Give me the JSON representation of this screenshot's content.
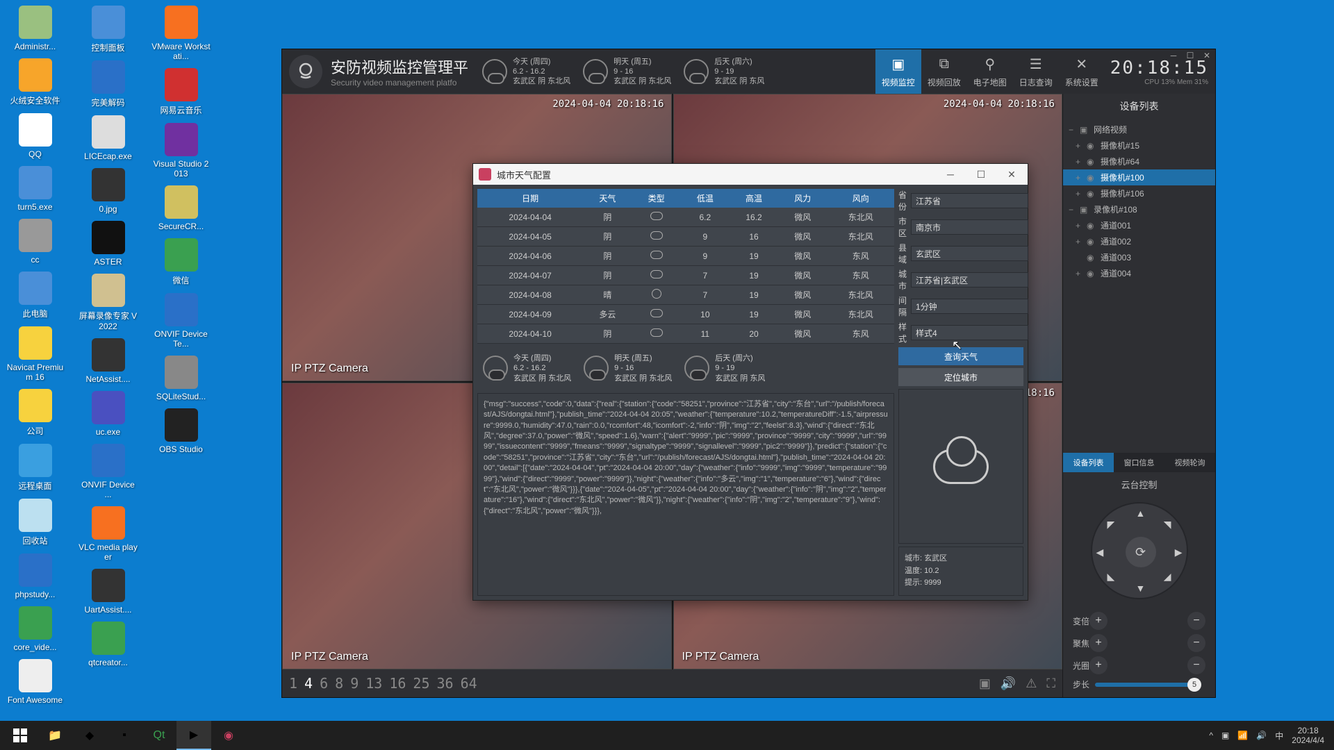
{
  "desktop_icons": [
    {
      "label": "Administr...",
      "bg": "#9ac080"
    },
    {
      "label": "火绒安全软件",
      "bg": "#f7a52a"
    },
    {
      "label": "QQ",
      "bg": "#fff"
    },
    {
      "label": "turn5.exe",
      "bg": "#4a8fd8"
    },
    {
      "label": "cc",
      "bg": "#999"
    },
    {
      "label": "此电脑",
      "bg": "#4a8fd8"
    },
    {
      "label": "Navicat Premium 16",
      "bg": "#f7d23e"
    },
    {
      "label": "公司",
      "bg": "#f7d23e"
    },
    {
      "label": "远程桌面",
      "bg": "#3a9fe0"
    },
    {
      "label": "回收站",
      "bg": "#bce0f0"
    },
    {
      "label": "phpstudy...",
      "bg": "#2a70c8"
    },
    {
      "label": "core_vide...",
      "bg": "#3aa050"
    },
    {
      "label": "Font Awesome",
      "bg": "#eee"
    },
    {
      "label": "控制面板",
      "bg": "#4a8fd8"
    },
    {
      "label": "完美解码",
      "bg": "#2a70c8"
    },
    {
      "label": "LICEcap.exe",
      "bg": "#ddd"
    },
    {
      "label": "0.jpg",
      "bg": "#333"
    },
    {
      "label": "ASTER",
      "bg": "#111"
    },
    {
      "label": "屏幕录像专家 V2022",
      "bg": "#d0c090"
    },
    {
      "label": "NetAssist....",
      "bg": "#333"
    },
    {
      "label": "uc.exe",
      "bg": "#4a50c0"
    },
    {
      "label": "ONVIF Device ...",
      "bg": "#2a70c8"
    },
    {
      "label": "VLC media player",
      "bg": "#f77020"
    },
    {
      "label": "UartAssist....",
      "bg": "#333"
    },
    {
      "label": "qtcreator...",
      "bg": "#3aa050"
    },
    {
      "label": "VMware Workstati...",
      "bg": "#f77020"
    },
    {
      "label": "网易云音乐",
      "bg": "#d03030"
    },
    {
      "label": "Visual Studio 2013",
      "bg": "#7030a0"
    },
    {
      "label": "SecureCR...",
      "bg": "#d0c060"
    },
    {
      "label": "微信",
      "bg": "#3aa050"
    },
    {
      "label": "ONVIF Device Te...",
      "bg": "#2a70c8"
    },
    {
      "label": "SQLiteStud...",
      "bg": "#888"
    },
    {
      "label": "OBS Studio",
      "bg": "#222"
    }
  ],
  "app": {
    "title_cn": "安防视频监控管理平",
    "title_en": "Security video management platfo",
    "clock": "20:18:15",
    "cpu": "CPU 13%  Mem 31%",
    "nav": [
      {
        "label": "视频监控",
        "active": true
      },
      {
        "label": "视频回放"
      },
      {
        "label": "电子地图"
      },
      {
        "label": "日志查询"
      },
      {
        "label": "系统设置"
      }
    ],
    "weather_strip": [
      {
        "day": "今天 (周四)",
        "temp": "6.2 - 16.2",
        "loc": "玄武区  阴 东北风"
      },
      {
        "day": "明天 (周五)",
        "temp": "9 - 16",
        "loc": "玄武区  阴 东北风"
      },
      {
        "day": "后天 (周六)",
        "temp": "9 - 19",
        "loc": "玄武区  阴 东风"
      }
    ],
    "video_ts": "2024-04-04 20:18:16",
    "video_label": "IP PTZ Camera",
    "layout_nums": [
      "1",
      "4",
      "6",
      "8",
      "9",
      "13",
      "16",
      "25",
      "36",
      "64"
    ],
    "active_layout": "4",
    "side": {
      "title": "设备列表",
      "tree": [
        {
          "lvl": 0,
          "label": "网络视频",
          "t": "−",
          "i": "▣"
        },
        {
          "lvl": 1,
          "label": "摄像机#15",
          "t": "+",
          "i": "◉"
        },
        {
          "lvl": 1,
          "label": "摄像机#64",
          "t": "+",
          "i": "◉"
        },
        {
          "lvl": 1,
          "label": "摄像机#100",
          "t": "+",
          "i": "◉",
          "sel": true
        },
        {
          "lvl": 1,
          "label": "摄像机#106",
          "t": "+",
          "i": "◉"
        },
        {
          "lvl": 0,
          "label": "录像机#108",
          "t": "−",
          "i": "▣"
        },
        {
          "lvl": 1,
          "label": "通道001",
          "t": "+",
          "i": "◉"
        },
        {
          "lvl": 1,
          "label": "通道002",
          "t": "+",
          "i": "◉"
        },
        {
          "lvl": 1,
          "label": "通道003",
          "t": "",
          "i": "◉"
        },
        {
          "lvl": 1,
          "label": "通道004",
          "t": "+",
          "i": "◉"
        }
      ],
      "tabs": [
        "设备列表",
        "窗口信息",
        "视频轮询"
      ],
      "active_tab": 0,
      "ptz_title": "云台控制",
      "ptz_rows": [
        {
          "label": "变倍"
        },
        {
          "label": "聚焦"
        },
        {
          "label": "光圈"
        }
      ],
      "step_label": "步长",
      "step_value": "5"
    }
  },
  "dialog": {
    "title": "城市天气配置",
    "headers": [
      "日期",
      "天气",
      "类型",
      "低温",
      "高温",
      "风力",
      "风向"
    ],
    "rows": [
      [
        "2024-04-04",
        "阴",
        "cloud",
        "6.2",
        "16.2",
        "微风",
        "东北风"
      ],
      [
        "2024-04-05",
        "阴",
        "cloud",
        "9",
        "16",
        "微风",
        "东北风"
      ],
      [
        "2024-04-06",
        "阴",
        "cloud",
        "9",
        "19",
        "微风",
        "东风"
      ],
      [
        "2024-04-07",
        "阴",
        "cloud",
        "7",
        "19",
        "微风",
        "东风"
      ],
      [
        "2024-04-08",
        "晴",
        "sun",
        "7",
        "19",
        "微风",
        "东北风"
      ],
      [
        "2024-04-09",
        "多云",
        "cloud",
        "10",
        "19",
        "微风",
        "东北风"
      ],
      [
        "2024-04-10",
        "阴",
        "cloud",
        "11",
        "20",
        "微风",
        "东风"
      ]
    ],
    "mid_strip": [
      {
        "day": "今天 (周四)",
        "temp": "6.2 - 16.2",
        "loc": "玄武区  阴 东北风"
      },
      {
        "day": "明天 (周五)",
        "temp": "9 - 16",
        "loc": "玄武区  阴 东北风"
      },
      {
        "day": "后天 (周六)",
        "temp": "9 - 19",
        "loc": "玄武区  阴 东风"
      }
    ],
    "json_text": "{\"msg\":\"success\",\"code\":0,\"data\":{\"real\":{\"station\":{\"code\":\"58251\",\"province\":\"江苏省\",\"city\":\"东台\",\"url\":\"/publish/forecast/AJS/dongtai.html\"},\"publish_time\":\"2024-04-04 20:05\",\"weather\":{\"temperature\":10.2,\"temperatureDiff\":-1.5,\"airpressure\":9999.0,\"humidity\":47.0,\"rain\":0.0,\"rcomfort\":48,\"icomfort\":-2,\"info\":\"阴\",\"img\":\"2\",\"feelst\":8.3},\"wind\":{\"direct\":\"东北风\",\"degree\":37.0,\"power\":\"微风\",\"speed\":1.6},\"warn\":{\"alert\":\"9999\",\"pic\":\"9999\",\"province\":\"9999\",\"city\":\"9999\",\"url\":\"9999\",\"issuecontent\":\"9999\",\"fmeans\":\"9999\",\"signaltype\":\"9999\",\"signallevel\":\"9999\",\"pic2\":\"9999\"}},\"predict\":{\"station\":{\"code\":\"58251\",\"province\":\"江苏省\",\"city\":\"东台\",\"url\":\"/publish/forecast/AJS/dongtai.html\"},\"publish_time\":\"2024-04-04 20:00\",\"detail\":[{\"date\":\"2024-04-04\",\"pt\":\"2024-04-04 20:00\",\"day\":{\"weather\":{\"info\":\"9999\",\"img\":\"9999\",\"temperature\":\"9999\"},\"wind\":{\"direct\":\"9999\",\"power\":\"9999\"}},\"night\":{\"weather\":{\"info\":\"多云\",\"img\":\"1\",\"temperature\":\"6\"},\"wind\":{\"direct\":\"东北风\",\"power\":\"微风\"}}},{\"date\":\"2024-04-05\",\"pt\":\"2024-04-04 20:00\",\"day\":{\"weather\":{\"info\":\"阴\",\"img\":\"2\",\"temperature\":\"16\"},\"wind\":{\"direct\":\"东北风\",\"power\":\"微风\"}},\"night\":{\"weather\":{\"info\":\"阴\",\"img\":\"2\",\"temperature\":\"9\"},\"wind\":{\"direct\":\"东北风\",\"power\":\"微风\"}}},",
    "form": {
      "province_label": "省份",
      "province": "江苏省",
      "city_label": "市区",
      "city": "南京市",
      "county_label": "县域",
      "county": "玄武区",
      "full_label": "城市",
      "full": "江苏省|玄武区",
      "interval_label": "间隔",
      "interval": "1分钟",
      "style_label": "样式",
      "style": "样式4"
    },
    "btn_query": "查询天气",
    "btn_locate": "定位城市",
    "info": {
      "city_l": "城市:",
      "city": "玄武区",
      "temp_l": "温度:",
      "temp": "10.2",
      "hint_l": "提示:",
      "hint": "9999"
    }
  },
  "taskbar": {
    "time": "20:18",
    "date": "2024/4/4"
  }
}
